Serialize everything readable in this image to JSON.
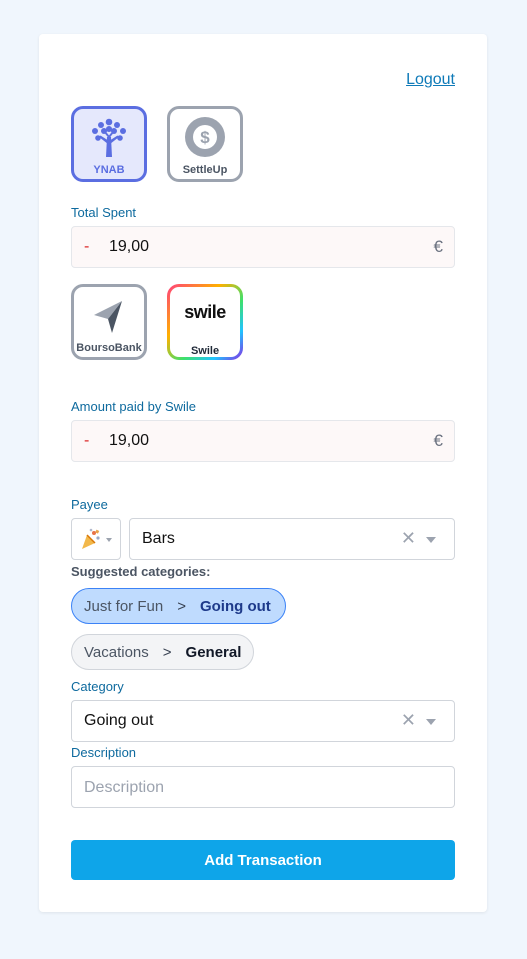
{
  "header": {
    "logout_label": "Logout"
  },
  "accounts": {
    "budget": [
      {
        "label": "YNAB",
        "icon": "tree-icon",
        "selected": true
      },
      {
        "label": "SettleUp",
        "icon": "dollar-coin-icon",
        "selected": false
      }
    ],
    "payment": [
      {
        "label": "BoursoBank",
        "icon": "bourso-arrow-icon"
      },
      {
        "label": "Swile",
        "logo_text": "swile",
        "selected": true
      }
    ]
  },
  "total_spent": {
    "label": "Total Spent",
    "sign": "-",
    "value": "19,00",
    "currency": "€"
  },
  "swile_amount": {
    "label": "Amount paid by Swile",
    "sign": "-",
    "value": "19,00",
    "currency": "€"
  },
  "payee": {
    "label": "Payee",
    "value": "Bars",
    "icon": "party-popper-icon"
  },
  "suggested": {
    "title": "Suggested categories:",
    "items": [
      {
        "parent": "Just for Fun",
        "separator": ">",
        "child": "Going out",
        "active": true
      },
      {
        "parent": "Vacations",
        "separator": ">",
        "child": "General",
        "active": false
      }
    ]
  },
  "category": {
    "label": "Category",
    "value": "Going out"
  },
  "description": {
    "label": "Description",
    "placeholder": "Description"
  },
  "submit": {
    "label": "Add Transaction"
  },
  "colors": {
    "accent": "#0ea5e9",
    "label": "#0e6a9e",
    "ynab": "#5b6ee1"
  }
}
